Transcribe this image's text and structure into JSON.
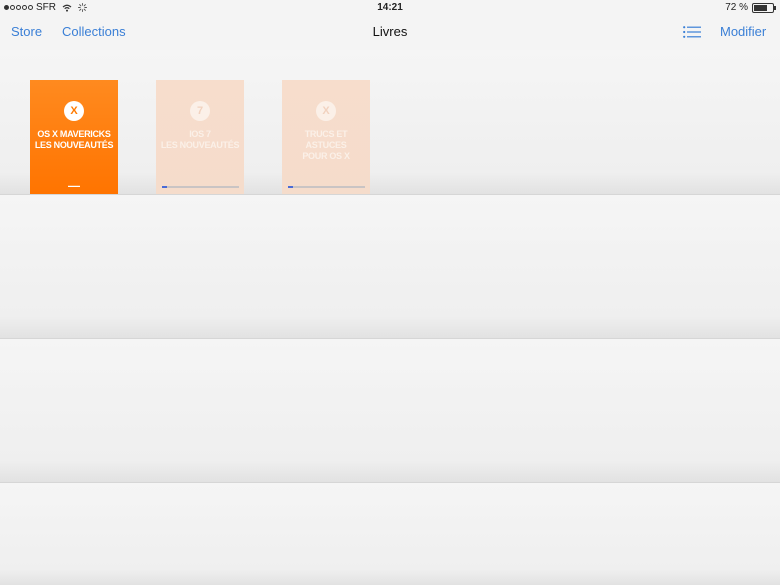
{
  "status_bar": {
    "carrier": "SFR",
    "time": "14:21",
    "battery": "72 %",
    "battery_level": 0.72,
    "signal_bars": 1
  },
  "nav": {
    "store_label": "Store",
    "collections_label": "Collections",
    "title": "Livres",
    "edit_label": "Modifier",
    "list_icon": "list-icon"
  },
  "books": [
    {
      "badge": "X",
      "title_line1": "OS X MAVERICKS",
      "title_line2": "LES NOUVEAUTÉS",
      "title_line3": "",
      "downloaded": true,
      "progress": null
    },
    {
      "badge": "7",
      "title_line1": "iOS 7",
      "title_line2": "LES NOUVEAUTÉS",
      "title_line3": "",
      "downloaded": false,
      "progress": 0.06
    },
    {
      "badge": "X",
      "title_line1": "TRUCS ET",
      "title_line2": "ASTUCES",
      "title_line3": "POUR OS X",
      "downloaded": false,
      "progress": 0.06
    }
  ]
}
